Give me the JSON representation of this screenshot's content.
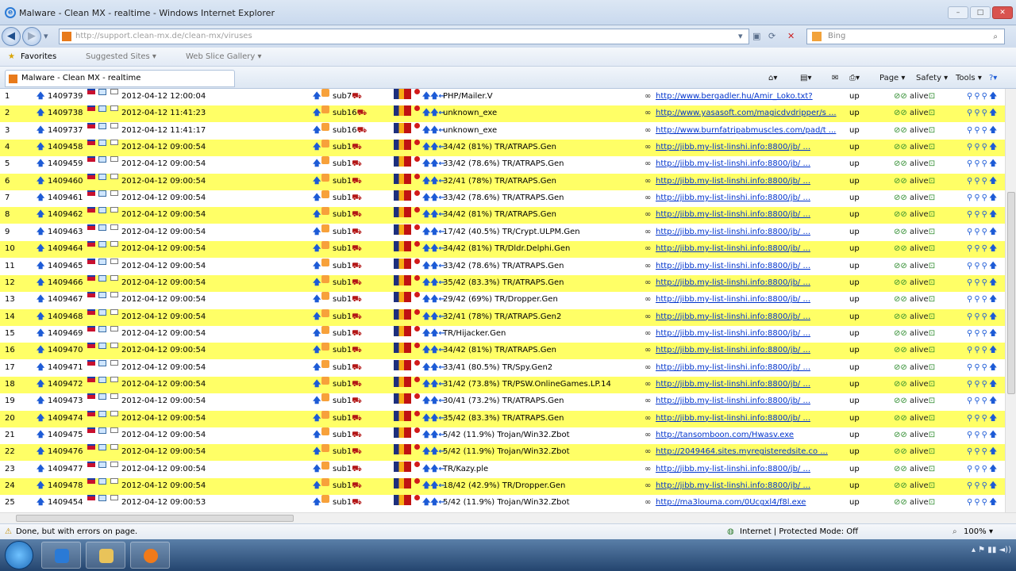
{
  "window": {
    "title": "Malware - Clean MX - realtime - Windows Internet Explorer"
  },
  "nav": {
    "address": "http://support.clean-mx.de/clean-mx/viruses",
    "search_placeholder": "Bing"
  },
  "favorites": {
    "label": "Favorites",
    "suggested": "Suggested Sites ▾",
    "webslice": "Web Slice Gallery ▾"
  },
  "tab": {
    "label": "Malware - Clean MX - realtime"
  },
  "commands": {
    "page": "Page ▾",
    "safety": "Safety ▾",
    "tools": "Tools ▾"
  },
  "rows": [
    {
      "n": "1",
      "id": "1409739",
      "date": "2012-04-12 12:00:04",
      "sub": "sub7",
      "virus": "PHP/Mailer.V",
      "url": "http://www.bergadler.hu/Amir_Loko.txt?",
      "up": "up",
      "alive": "alive"
    },
    {
      "n": "2",
      "id": "1409738",
      "date": "2012-04-12 11:41:23",
      "sub": "sub16",
      "virus": "unknown_exe",
      "url": "http://www.yasasoft.com/magicdvdripper/s ...",
      "up": "up",
      "alive": "alive"
    },
    {
      "n": "3",
      "id": "1409737",
      "date": "2012-04-12 11:41:17",
      "sub": "sub16",
      "virus": "unknown_exe",
      "url": "http://www.burnfatripabmuscles.com/pad/t ...",
      "up": "up",
      "alive": "alive"
    },
    {
      "n": "4",
      "id": "1409458",
      "date": "2012-04-12 09:00:54",
      "sub": "sub1",
      "virus": "34/42 (81%) TR/ATRAPS.Gen",
      "url": "http://jibb.my-list-linshi.info:8800/jb/ ...",
      "up": "up",
      "alive": "alive"
    },
    {
      "n": "5",
      "id": "1409459",
      "date": "2012-04-12 09:00:54",
      "sub": "sub1",
      "virus": "33/42 (78.6%) TR/ATRAPS.Gen",
      "url": "http://jibb.my-list-linshi.info:8800/jb/ ...",
      "up": "up",
      "alive": "alive"
    },
    {
      "n": "6",
      "id": "1409460",
      "date": "2012-04-12 09:00:54",
      "sub": "sub1",
      "virus": "32/41 (78%) TR/ATRAPS.Gen",
      "url": "http://jibb.my-list-linshi.info:8800/jb/ ...",
      "up": "up",
      "alive": "alive"
    },
    {
      "n": "7",
      "id": "1409461",
      "date": "2012-04-12 09:00:54",
      "sub": "sub1",
      "virus": "33/42 (78.6%) TR/ATRAPS.Gen",
      "url": "http://jibb.my-list-linshi.info:8800/jb/ ...",
      "up": "up",
      "alive": "alive"
    },
    {
      "n": "8",
      "id": "1409462",
      "date": "2012-04-12 09:00:54",
      "sub": "sub1",
      "virus": "34/42 (81%) TR/ATRAPS.Gen",
      "url": "http://jibb.my-list-linshi.info:8800/jb/ ...",
      "up": "up",
      "alive": "alive"
    },
    {
      "n": "9",
      "id": "1409463",
      "date": "2012-04-12 09:00:54",
      "sub": "sub1",
      "virus": "17/42 (40.5%) TR/Crypt.ULPM.Gen",
      "url": "http://jibb.my-list-linshi.info:8800/jb/ ...",
      "up": "up",
      "alive": "alive"
    },
    {
      "n": "10",
      "id": "1409464",
      "date": "2012-04-12 09:00:54",
      "sub": "sub1",
      "virus": "34/42 (81%) TR/Dldr.Delphi.Gen",
      "url": "http://jibb.my-list-linshi.info:8800/jb/ ...",
      "up": "up",
      "alive": "alive"
    },
    {
      "n": "11",
      "id": "1409465",
      "date": "2012-04-12 09:00:54",
      "sub": "sub1",
      "virus": "33/42 (78.6%) TR/ATRAPS.Gen",
      "url": "http://jibb.my-list-linshi.info:8800/jb/ ...",
      "up": "up",
      "alive": "alive"
    },
    {
      "n": "12",
      "id": "1409466",
      "date": "2012-04-12 09:00:54",
      "sub": "sub1",
      "virus": "35/42 (83.3%) TR/ATRAPS.Gen",
      "url": "http://jibb.my-list-linshi.info:8800/jb/ ...",
      "up": "up",
      "alive": "alive"
    },
    {
      "n": "13",
      "id": "1409467",
      "date": "2012-04-12 09:00:54",
      "sub": "sub1",
      "virus": "29/42 (69%) TR/Dropper.Gen",
      "url": "http://jibb.my-list-linshi.info:8800/jb/ ...",
      "up": "up",
      "alive": "alive"
    },
    {
      "n": "14",
      "id": "1409468",
      "date": "2012-04-12 09:00:54",
      "sub": "sub1",
      "virus": "32/41 (78%) TR/ATRAPS.Gen2",
      "url": "http://jibb.my-list-linshi.info:8800/jb/ ...",
      "up": "up",
      "alive": "alive"
    },
    {
      "n": "15",
      "id": "1409469",
      "date": "2012-04-12 09:00:54",
      "sub": "sub1",
      "virus": "TR/Hijacker.Gen",
      "url": "http://jibb.my-list-linshi.info:8800/jb/ ...",
      "up": "up",
      "alive": "alive"
    },
    {
      "n": "16",
      "id": "1409470",
      "date": "2012-04-12 09:00:54",
      "sub": "sub1",
      "virus": "34/42 (81%) TR/ATRAPS.Gen",
      "url": "http://jibb.my-list-linshi.info:8800/jb/ ...",
      "up": "up",
      "alive": "alive"
    },
    {
      "n": "17",
      "id": "1409471",
      "date": "2012-04-12 09:00:54",
      "sub": "sub1",
      "virus": "33/41 (80.5%) TR/Spy.Gen2",
      "url": "http://jibb.my-list-linshi.info:8800/jb/ ...",
      "up": "up",
      "alive": "alive"
    },
    {
      "n": "18",
      "id": "1409472",
      "date": "2012-04-12 09:00:54",
      "sub": "sub1",
      "virus": "31/42 (73.8%) TR/PSW.OnlineGames.LP.14",
      "url": "http://jibb.my-list-linshi.info:8800/jb/ ...",
      "up": "up",
      "alive": "alive"
    },
    {
      "n": "19",
      "id": "1409473",
      "date": "2012-04-12 09:00:54",
      "sub": "sub1",
      "virus": "30/41 (73.2%) TR/ATRAPS.Gen",
      "url": "http://jibb.my-list-linshi.info:8800/jb/ ...",
      "up": "up",
      "alive": "alive"
    },
    {
      "n": "20",
      "id": "1409474",
      "date": "2012-04-12 09:00:54",
      "sub": "sub1",
      "virus": "35/42 (83.3%) TR/ATRAPS.Gen",
      "url": "http://jibb.my-list-linshi.info:8800/jb/ ...",
      "up": "up",
      "alive": "alive"
    },
    {
      "n": "21",
      "id": "1409475",
      "date": "2012-04-12 09:00:54",
      "sub": "sub1",
      "virus": "5/42 (11.9%) Trojan/Win32.Zbot",
      "url": "http://tansomboon.com/Hwasv.exe",
      "up": "up",
      "alive": "alive"
    },
    {
      "n": "22",
      "id": "1409476",
      "date": "2012-04-12 09:00:54",
      "sub": "sub1",
      "virus": "5/42 (11.9%) Trojan/Win32.Zbot",
      "url": "http://2049464.sites.myregisteredsite.co ...",
      "up": "up",
      "alive": "alive"
    },
    {
      "n": "23",
      "id": "1409477",
      "date": "2012-04-12 09:00:54",
      "sub": "sub1",
      "virus": "TR/Kazy.ple",
      "url": "http://jibb.my-list-linshi.info:8800/jb/ ...",
      "up": "up",
      "alive": "alive"
    },
    {
      "n": "24",
      "id": "1409478",
      "date": "2012-04-12 09:00:54",
      "sub": "sub1",
      "virus": "18/42 (42.9%) TR/Dropper.Gen",
      "url": "http://jibb.my-list-linshi.info:8800/jb/ ...",
      "up": "up",
      "alive": "alive"
    },
    {
      "n": "25",
      "id": "1409454",
      "date": "2012-04-12 09:00:53",
      "sub": "sub1",
      "virus": "5/42 (11.9%) Trojan/Win32.Zbot",
      "url": "http://ma3louma.com/0Ucgxl4/f8l.exe",
      "up": "up",
      "alive": "alive"
    }
  ],
  "status": {
    "text": "Done, but with errors on page.",
    "zone": "Internet | Protected Mode: Off",
    "zoom": "100%"
  },
  "colors": {
    "row_highlight": "#ffff66",
    "link": "#0033cc"
  }
}
